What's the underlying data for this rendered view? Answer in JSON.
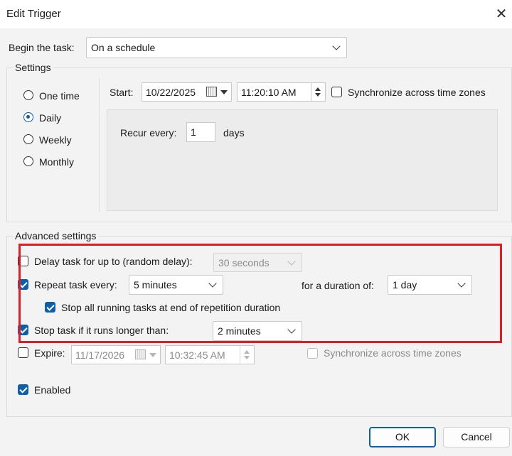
{
  "window": {
    "title": "Edit Trigger"
  },
  "begin_task": {
    "label": "Begin the task:",
    "value": "On a schedule"
  },
  "settings": {
    "group_label": "Settings",
    "schedule_options": [
      {
        "label": "One time",
        "selected": false
      },
      {
        "label": "Daily",
        "selected": true
      },
      {
        "label": "Weekly",
        "selected": false
      },
      {
        "label": "Monthly",
        "selected": false
      }
    ],
    "start_label": "Start:",
    "start_date": "10/22/2025",
    "start_time": "11:20:10 AM",
    "sync_label": "Synchronize across time zones",
    "sync_checked": false,
    "recur_label": "Recur every:",
    "recur_value": "1",
    "recur_unit": "days"
  },
  "advanced": {
    "group_label": "Advanced settings",
    "delay": {
      "label": "Delay task for up to (random delay):",
      "checked": false,
      "value": "30 seconds",
      "enabled": false
    },
    "repeat": {
      "label": "Repeat task every:",
      "checked": true,
      "value": "5 minutes",
      "duration_label": "for a duration of:",
      "duration_value": "1 day"
    },
    "stop_running": {
      "label": "Stop all running tasks at end of repetition duration",
      "checked": true
    },
    "stop_longer": {
      "label": "Stop task if it runs longer than:",
      "checked": true,
      "value": "2 minutes"
    },
    "expire": {
      "label": "Expire:",
      "checked": false,
      "date": "11/17/2026",
      "time": "10:32:45 AM",
      "sync_label": "Synchronize across time zones",
      "enabled": false
    },
    "enabled": {
      "label": "Enabled",
      "checked": true
    }
  },
  "buttons": {
    "ok": "OK",
    "cancel": "Cancel"
  },
  "colors": {
    "accent": "#0f5fa8",
    "highlight_box": "#e01c24",
    "background": "#f3f3f3"
  }
}
